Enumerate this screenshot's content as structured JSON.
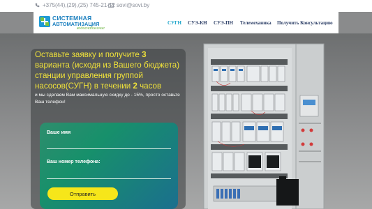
{
  "topbar": {
    "phone": "+375(44),(29),(25) 745-21-12",
    "email": "sovi@sovi.by"
  },
  "logo": {
    "line1": "СИСТЕМНАЯ",
    "line2": "АВТОМАТИЗАЦИЯ",
    "tagline": "водоснабжение"
  },
  "nav": {
    "items": [
      "СУГН",
      "СУЭ-КН",
      "СУЭ-ПН",
      "Телемеханика",
      "Получить Консультацию"
    ],
    "active_index": 0
  },
  "hero": {
    "headline_part1": "Оставьте заявку и получите ",
    "headline_num1": "3",
    "headline_part2": " варианта (исходя из Вашего бюджета) станции управления группой насосов(СУГН) в течении ",
    "headline_num2": "2",
    "headline_part3": " часов",
    "subtext": "и мы сделаем Вам максимальную скидку до - 15%, просто оставьте Ваш телефон!"
  },
  "form": {
    "name_label": "Ваше имя",
    "phone_label": "Ваш номер телефона:",
    "submit_label": "Отправить"
  },
  "colors": {
    "accent_yellow": "#f6e61a",
    "headline_yellow": "#f0e23a",
    "nav_active": "#18a3c9",
    "nav_text": "#2c3e66",
    "form_green": "#17906b"
  }
}
